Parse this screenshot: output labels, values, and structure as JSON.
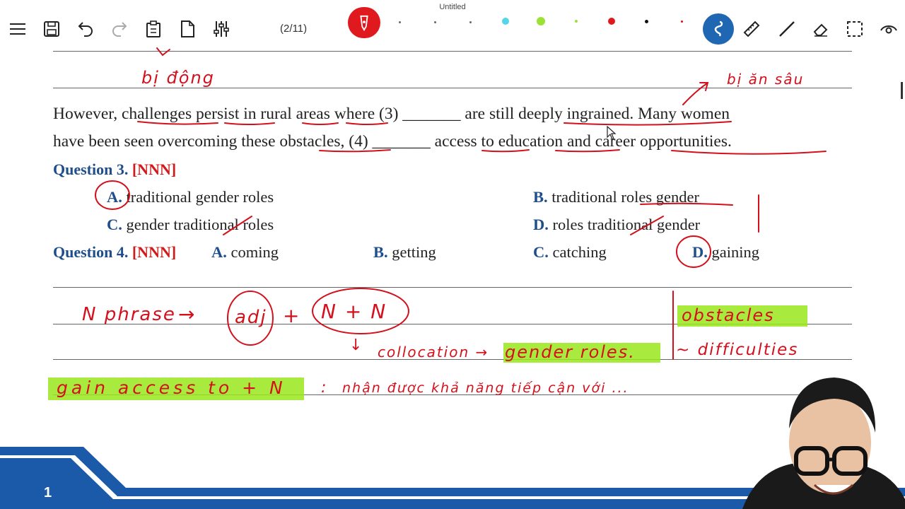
{
  "window": {
    "title": "Untitled"
  },
  "toolbar": {
    "page_indicator": "(2/11)",
    "icons": [
      "menu-icon",
      "save-icon",
      "undo-icon",
      "redo-icon",
      "paste-icon",
      "new-page-icon",
      "settings-sliders-icon",
      "pen-icon",
      "lasso-icon",
      "ruler-icon",
      "line-icon",
      "eraser-icon",
      "selection-icon",
      "view-icon"
    ],
    "colors": [
      "#55d6e8",
      "#9be234",
      "#9be234",
      "#e0191e",
      "#111111"
    ]
  },
  "doc": {
    "passage_line1": "However, challenges persist in rural areas where (3) _______ are still deeply ingrained. Many women",
    "passage_line2": "have been seen overcoming these obstacles, (4) _______ access to education and career opportunities.",
    "q3": {
      "label": "Question 3.",
      "tag": "[NNN]",
      "a_letter": "A.",
      "a": "traditional gender roles",
      "b_letter": "B.",
      "b": "traditional roles gender",
      "c_letter": "C.",
      "c": "gender traditional roles",
      "d_letter": "D.",
      "d": "roles traditional gender"
    },
    "q4": {
      "label": "Question 4.",
      "tag": "[NNN]",
      "a_letter": "A.",
      "a": "coming",
      "b_letter": "B.",
      "b": "getting",
      "c_letter": "C.",
      "c": "catching",
      "d_letter": "D.",
      "d": "gaining"
    }
  },
  "annotations": {
    "bi_dong": "bị động",
    "bi_an_sau": "bị ăn sâu",
    "n_phrase": "N phrase",
    "arrow1": "→",
    "adj": "adj",
    "plus": "+",
    "n_plus_n": "N + N",
    "down_arrow": "↓",
    "collocation": "collocation →",
    "gender_roles": "gender roles.",
    "obstacles": "obstacles",
    "difficulties": "~ difficulties",
    "gain_access": "gain access to + N",
    "colon": ":",
    "meaning": "nhận được khả năng tiếp cận với ..."
  },
  "footer": {
    "page_number": "1"
  },
  "colors": {
    "accent_blue": "#1f4e8c",
    "tag_red": "#d11a1a",
    "ink_red": "#d3101c",
    "highlight": "#9ae61c",
    "footer_blue": "#1b5aa8"
  }
}
